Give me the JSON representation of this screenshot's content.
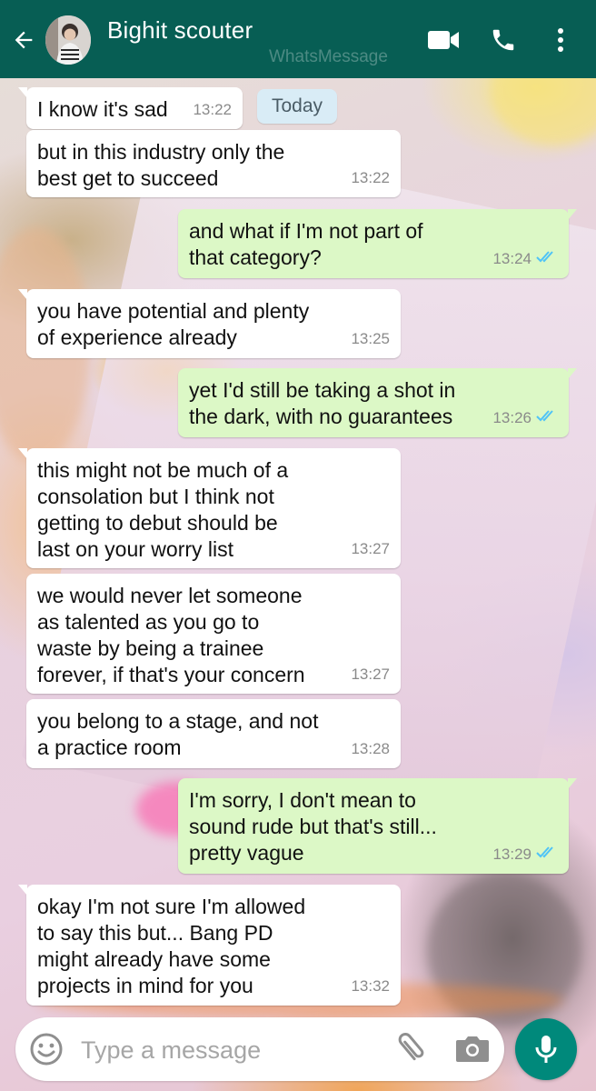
{
  "header": {
    "contact_name": "Bighit scouter",
    "watermark": "WhatsMessage",
    "icons": [
      "back-arrow-icon",
      "video-call-icon",
      "phone-icon",
      "more-vert-icon"
    ],
    "color": "#075e54"
  },
  "date_chip": "Today",
  "messages": [
    {
      "dir": "in",
      "text": "I know it's sad",
      "time": "13:22"
    },
    {
      "dir": "in",
      "text": "but in this industry only the\nbest get to succeed",
      "time": "13:22"
    },
    {
      "dir": "out",
      "text": "and what if I'm not part of\nthat category?",
      "time": "13:24",
      "read": true
    },
    {
      "dir": "in",
      "text": "you have potential and plenty\nof experience already",
      "time": "13:25"
    },
    {
      "dir": "out",
      "text": "yet I'd still be taking a shot in\nthe dark, with no guarantees",
      "time": "13:26",
      "read": true
    },
    {
      "dir": "in",
      "text": "this might not be much of a\nconsolation but I think not\ngetting to debut should be\nlast on your worry list",
      "time": "13:27"
    },
    {
      "dir": "in",
      "text": "we would never let someone\nas talented as you go to\nwaste by being a trainee\nforever, if that's your concern",
      "time": "13:27"
    },
    {
      "dir": "in",
      "text": "you belong to a stage, and not\na practice room",
      "time": "13:28"
    },
    {
      "dir": "out",
      "text": "I'm sorry, I don't mean to\nsound rude but that's still...\npretty vague",
      "time": "13:29",
      "read": true
    },
    {
      "dir": "in",
      "text": "okay I'm not sure I'm allowed\nto say this but... Bang PD\nmight already have some\nprojects in mind for you",
      "time": "13:32"
    }
  ],
  "composer": {
    "placeholder": "Type a message",
    "icons": [
      "emoji-icon",
      "attachment-icon",
      "camera-icon",
      "mic-icon"
    ],
    "send_color": "#00897b"
  },
  "colors": {
    "incoming_bubble": "#ffffff",
    "outgoing_bubble": "#dcf8c6",
    "read_ticks": "#4fc3f7"
  }
}
